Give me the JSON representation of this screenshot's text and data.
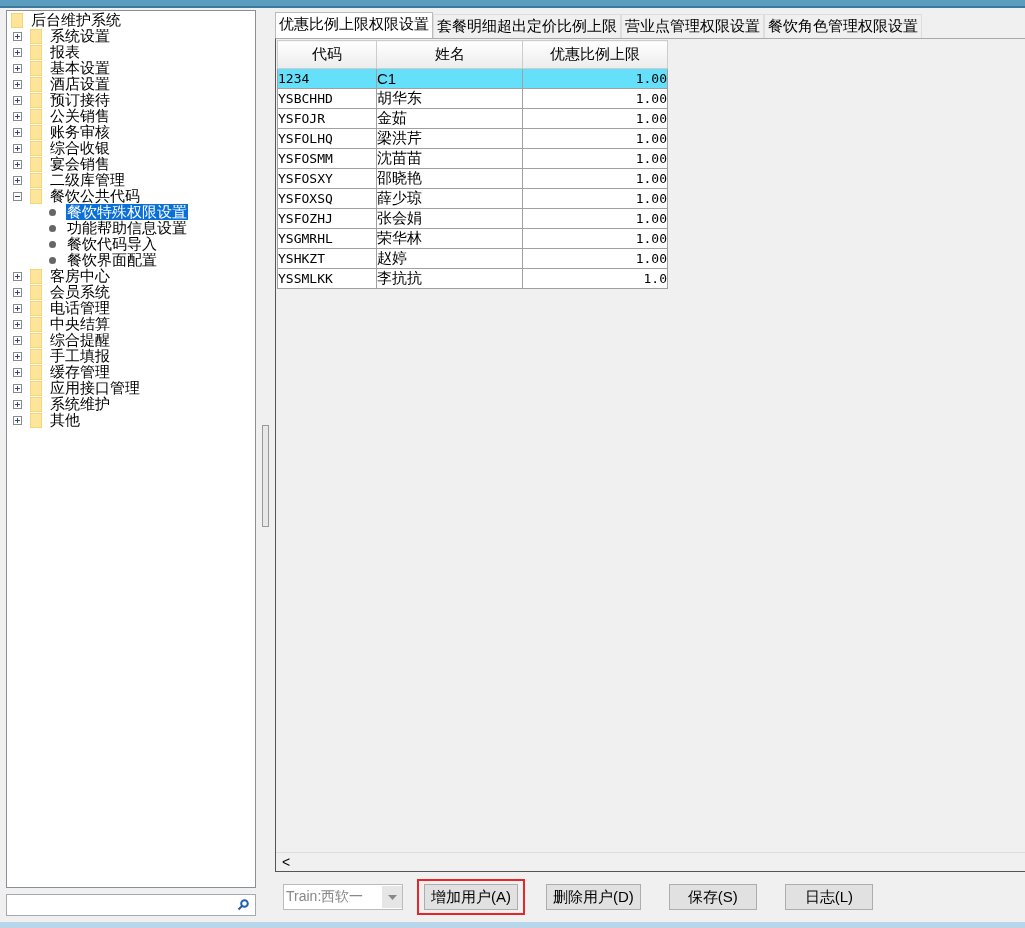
{
  "tree": {
    "label": "后台维护系统",
    "selected": false,
    "children": [
      {
        "label": "系统设置",
        "expanded": false,
        "selected": false
      },
      {
        "label": "报表",
        "expanded": false,
        "selected": false
      },
      {
        "label": "基本设置",
        "expanded": false,
        "selected": false
      },
      {
        "label": "酒店设置",
        "expanded": false,
        "selected": false
      },
      {
        "label": "预订接待",
        "expanded": false,
        "selected": false
      },
      {
        "label": "公关销售",
        "expanded": false,
        "selected": false
      },
      {
        "label": "账务审核",
        "expanded": false,
        "selected": false
      },
      {
        "label": "综合收银",
        "expanded": false,
        "selected": false
      },
      {
        "label": "宴会销售",
        "expanded": false,
        "selected": false
      },
      {
        "label": "二级库管理",
        "expanded": false,
        "selected": false
      },
      {
        "label": "餐饮公共代码",
        "expanded": true,
        "selected": false,
        "children": [
          {
            "label": "餐饮特殊权限设置",
            "kind": "leaf",
            "selected": true
          },
          {
            "label": "功能帮助信息设置",
            "kind": "leaf",
            "selected": false
          },
          {
            "label": "餐饮代码导入",
            "kind": "leaf",
            "selected": false
          },
          {
            "label": "餐饮界面配置",
            "kind": "leaf",
            "selected": false
          }
        ]
      },
      {
        "label": "客房中心",
        "expanded": false,
        "selected": false
      },
      {
        "label": "会员系统",
        "expanded": false,
        "selected": false
      },
      {
        "label": "电话管理",
        "expanded": false,
        "selected": false
      },
      {
        "label": "中央结算",
        "expanded": false,
        "selected": false
      },
      {
        "label": "综合提醒",
        "expanded": false,
        "selected": false
      },
      {
        "label": "手工填报",
        "expanded": false,
        "selected": false
      },
      {
        "label": "缓存管理",
        "expanded": false,
        "selected": false
      },
      {
        "label": "应用接口管理",
        "expanded": false,
        "selected": false
      },
      {
        "label": "系统维护",
        "expanded": false,
        "selected": false
      },
      {
        "label": "其他",
        "expanded": false,
        "selected": false
      }
    ]
  },
  "tabs": [
    {
      "label": "优惠比例上限权限设置",
      "selected": true
    },
    {
      "label": "套餐明细超出定价比例上限",
      "selected": false
    },
    {
      "label": "营业点管理权限设置",
      "selected": false
    },
    {
      "label": "餐饮角色管理权限设置",
      "selected": false
    }
  ],
  "table": {
    "columns": [
      "代码",
      "姓名",
      "优惠比例上限"
    ],
    "rows": [
      {
        "cells": [
          "1234",
          "C1",
          "1.00"
        ],
        "selected": true
      },
      {
        "cells": [
          "YSBCHHD",
          "胡华东",
          "1.00"
        ],
        "selected": false
      },
      {
        "cells": [
          "YSFOJR",
          "金茹",
          "1.00"
        ],
        "selected": false
      },
      {
        "cells": [
          "YSFOLHQ",
          "梁洪芹",
          "1.00"
        ],
        "selected": false
      },
      {
        "cells": [
          "YSFOSMM",
          "沈苗苗",
          "1.00"
        ],
        "selected": false
      },
      {
        "cells": [
          "YSFOSXY",
          "邵晓艳",
          "1.00"
        ],
        "selected": false
      },
      {
        "cells": [
          "YSFOXSQ",
          "薛少琼",
          "1.00"
        ],
        "selected": false
      },
      {
        "cells": [
          "YSFOZHJ",
          "张会娟",
          "1.00"
        ],
        "selected": false
      },
      {
        "cells": [
          "YSGMRHL",
          "荣华林",
          "1.00"
        ],
        "selected": false
      },
      {
        "cells": [
          "YSHKZT",
          "赵婷",
          "1.00"
        ],
        "selected": false
      },
      {
        "cells": [
          "YSSMLKK",
          "李抗抗",
          "1.0"
        ],
        "selected": false
      }
    ]
  },
  "scroll_left": "<",
  "combo": {
    "value": "Train:西软一",
    "disabled": true
  },
  "buttons": [
    {
      "label": "增加用户(A)",
      "highlighted": true
    },
    {
      "label": "删除用户(D)",
      "highlighted": false
    },
    {
      "label": "保存(S)",
      "highlighted": false
    },
    {
      "label": "日志(L)",
      "highlighted": false
    }
  ]
}
